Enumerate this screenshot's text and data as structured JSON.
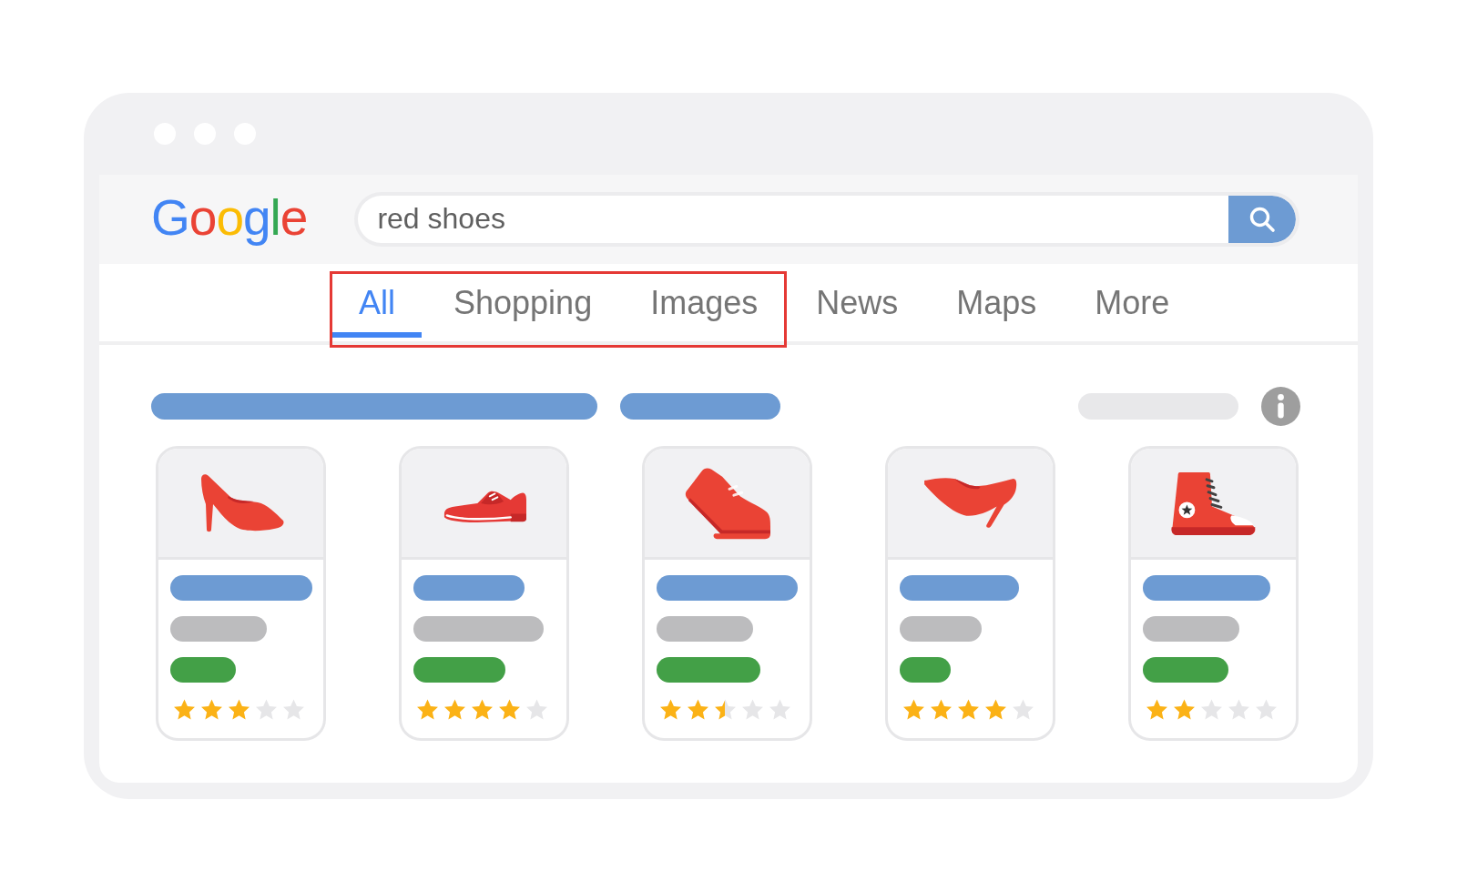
{
  "logo": "Google",
  "search": {
    "value": "red shoes"
  },
  "tabs": [
    {
      "label": "All",
      "selected": true,
      "highlighted": true
    },
    {
      "label": "Shopping",
      "selected": false,
      "highlighted": true
    },
    {
      "label": "Images",
      "selected": false,
      "highlighted": true
    },
    {
      "label": "News",
      "selected": false,
      "highlighted": false
    },
    {
      "label": "Maps",
      "selected": false,
      "highlighted": false
    },
    {
      "label": "More",
      "selected": false,
      "highlighted": false
    }
  ],
  "results": {
    "cards": [
      {
        "kind": "pump",
        "stars": 3
      },
      {
        "kind": "oxford",
        "stars": 4
      },
      {
        "kind": "sneaker",
        "stars": 2.5
      },
      {
        "kind": "stiletto",
        "stars": 4
      },
      {
        "kind": "high-top",
        "stars": 2
      }
    ]
  }
}
